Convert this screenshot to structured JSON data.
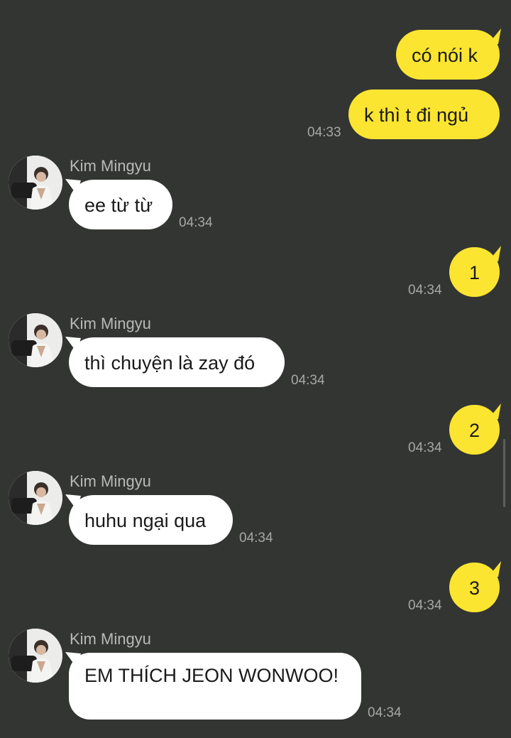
{
  "conversation": {
    "contact_name": "Kim Mingyu",
    "messages": [
      {
        "direction": "outgoing",
        "text": "có nói k",
        "time": ""
      },
      {
        "direction": "outgoing",
        "text": "k thì t đi ngủ",
        "time": "04:33"
      },
      {
        "direction": "incoming",
        "sender": "Kim Mingyu",
        "text": "ee từ từ",
        "time": "04:34"
      },
      {
        "direction": "outgoing",
        "text": "1",
        "time": "04:34"
      },
      {
        "direction": "incoming",
        "sender": "Kim Mingyu",
        "text": "thì chuyện là zay đó",
        "time": "04:34"
      },
      {
        "direction": "outgoing",
        "text": "2",
        "time": "04:34"
      },
      {
        "direction": "incoming",
        "sender": "Kim Mingyu",
        "text": "huhu ngại qua",
        "time": "04:34"
      },
      {
        "direction": "outgoing",
        "text": "3",
        "time": "04:34"
      },
      {
        "direction": "incoming",
        "sender": "Kim Mingyu",
        "text": "EM THÍCH JEON WONWOO!",
        "time": "04:34"
      }
    ]
  },
  "colors": {
    "background": "#333532",
    "outgoing_bubble": "#fbe530",
    "incoming_bubble": "#ffffff",
    "timestamp": "#a7a8a5",
    "sender_name": "#b9bab7"
  },
  "icons": {
    "avatar": "avatar-icon"
  }
}
